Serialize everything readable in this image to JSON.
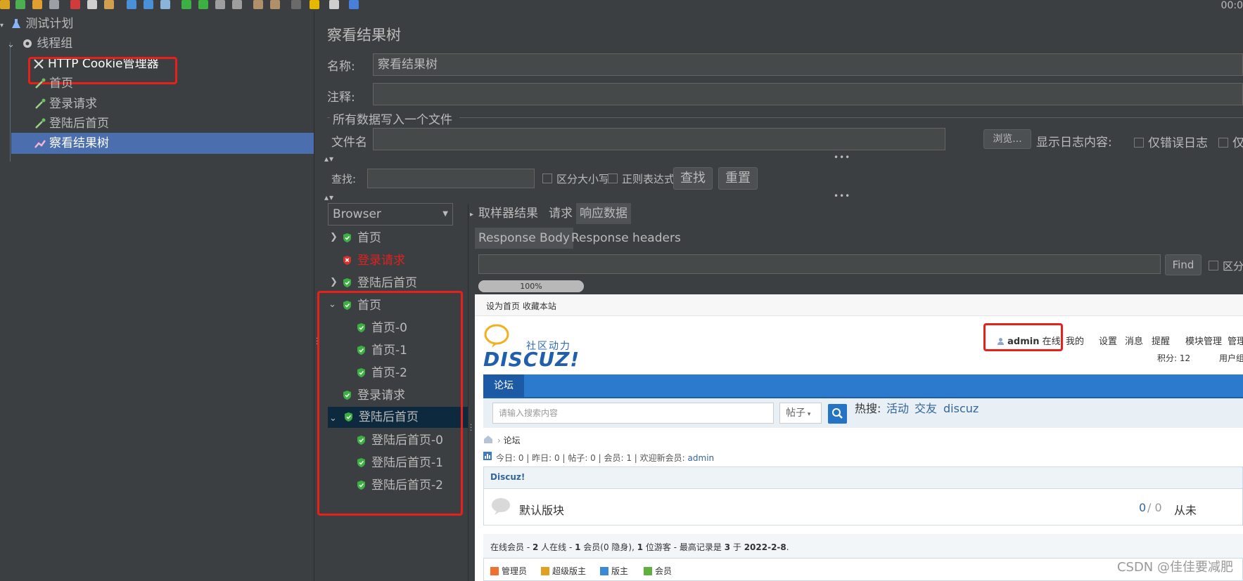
{
  "toolbar": {
    "clock": "00:0"
  },
  "tree": {
    "items": [
      {
        "label": "测试计划"
      },
      {
        "label": "线程组"
      },
      {
        "label": "HTTP Cookie管理器"
      },
      {
        "label": "首页"
      },
      {
        "label": "登录请求"
      },
      {
        "label": "登陆后首页"
      },
      {
        "label": "察看结果树"
      }
    ]
  },
  "panel": {
    "title": "察看结果树",
    "name_label": "名称:",
    "name_value": "察看结果树",
    "comment_label": "注释:",
    "file_group": "所有数据写入一个文件",
    "filename_label": "文件名",
    "browse": "浏览...",
    "log_label": "显示日志内容:",
    "errors_only": "仅错误日志",
    "success_only": "仅",
    "search_label": "查找:",
    "case_sensitive": "区分大小写",
    "regex": "正则表达式",
    "find_btn": "查找",
    "reset_btn": "重置"
  },
  "renderer": {
    "selected": "Browser"
  },
  "results": [
    {
      "label": "首页"
    },
    {
      "label": "登录请求"
    },
    {
      "label": "登陆后首页"
    },
    {
      "label": "首页"
    },
    {
      "label": "首页-0"
    },
    {
      "label": "首页-1"
    },
    {
      "label": "首页-2"
    },
    {
      "label": "登录请求"
    },
    {
      "label": "登陆后首页"
    },
    {
      "label": "登陆后首页-0"
    },
    {
      "label": "登陆后首页-1"
    },
    {
      "label": "登陆后首页-2"
    }
  ],
  "tabs": {
    "sampler": "取样器结果",
    "request": "请求",
    "response": "响应数据"
  },
  "subtabs": {
    "body": "Response Body",
    "headers": "Response headers"
  },
  "find": {
    "button": "Find",
    "case": "区分"
  },
  "progress": {
    "value": 100,
    "label": "100%"
  },
  "web": {
    "top_links": "设为首页  收藏本站",
    "logo_top": "社区动力",
    "logo_bottom": "DISCUZ!",
    "user": "admin",
    "online": "在线",
    "menu": [
      "我的",
      "设置",
      "消息",
      "提醒",
      "模块管理",
      "管理"
    ],
    "points": "积分: 12",
    "user_group": "用户组",
    "nav": "论坛",
    "search_placeholder": "请输入搜索内容",
    "search_type": "帖子",
    "hot_label": "热搜:",
    "hot": [
      "活动",
      "交友",
      "discuz"
    ],
    "breadcrumb": "论坛",
    "stats": "今日: 0  |  昨日: 0  |  帖子: 0  |  会员: 1  |  欢迎新会员:",
    "new_member": "admin",
    "forum_category": "Discuz!",
    "forum_name": "默认版块",
    "forum_count": "0",
    "forum_count2": "/ 0",
    "forum_last": "从未",
    "online_info_pre": "在线会员 - ",
    "online_info_bold": "2",
    "online_info_mid": " 人在线 - ",
    "online_info_b2": "1",
    "online_info_rest": " 会员(0 隐身), ",
    "online_info_b3": "1",
    "online_info_tail": " 位游客 - 最高记录是 ",
    "online_info_b4": "3",
    "online_info_at": " 于 ",
    "online_info_b5": "2022-2-8",
    "online_info_end": ".",
    "legend": [
      "管理员",
      "超级版主",
      "版主",
      "会员"
    ]
  },
  "watermark": "CSDN @佳佳要减肥",
  "colors": {
    "selection": "#4b6eaf",
    "highlight_box": "#e8201a",
    "error_text": "#e02020",
    "success_shield": "#3cb043"
  }
}
